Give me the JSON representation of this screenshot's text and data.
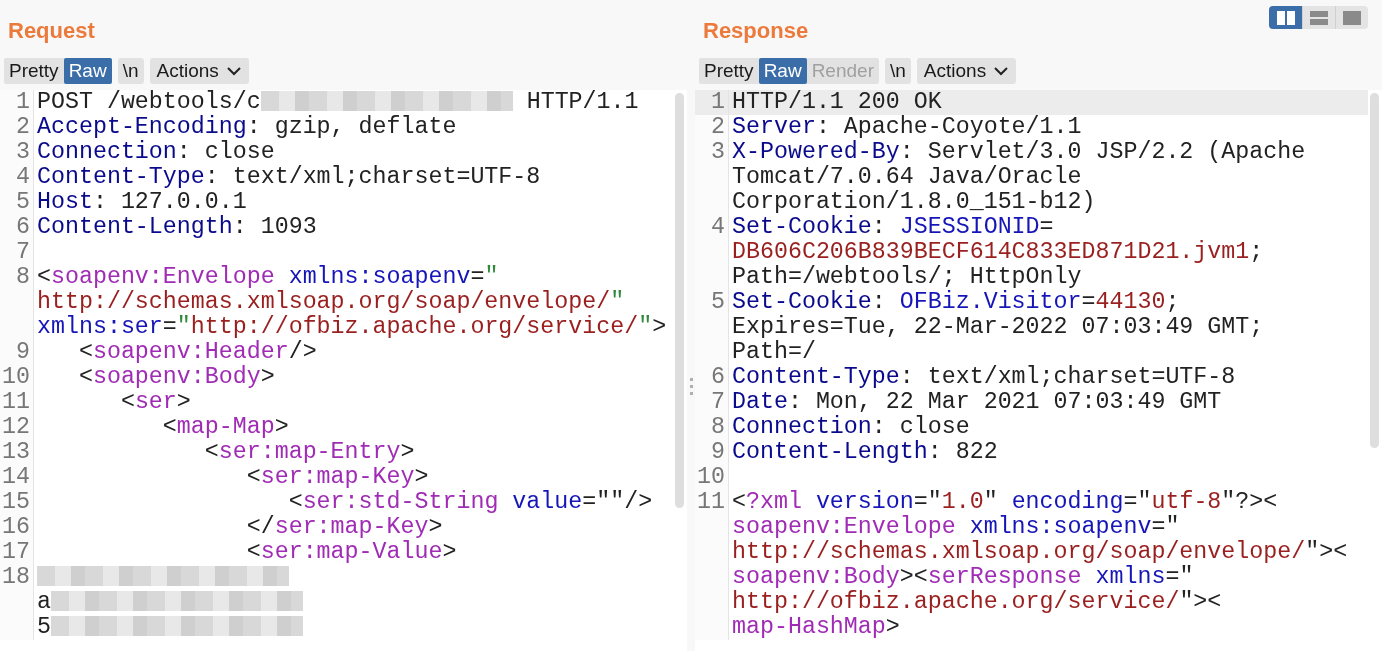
{
  "view_modes": [
    {
      "kind": "columns",
      "selected": true
    },
    {
      "kind": "rows",
      "selected": false
    },
    {
      "kind": "single",
      "selected": false
    }
  ],
  "panels": [
    {
      "title": "Request",
      "toolbar": [
        {
          "label": "Pretty",
          "kind": "tab",
          "selected": false,
          "disabled": false
        },
        {
          "label": "Raw",
          "kind": "tab",
          "selected": true,
          "disabled": false
        },
        {
          "label": "\\n",
          "kind": "toggle",
          "selected": false,
          "disabled": false
        },
        {
          "label": "Actions",
          "kind": "menu",
          "selected": false,
          "disabled": false
        }
      ],
      "lines": [
        {
          "number": "1",
          "highlighted": false,
          "rows": [
            {
              "spans": [
                {
                  "kind": "plain",
                  "text": "POST /webtools/c"
                },
                {
                  "kind": "redacted"
                },
                {
                  "kind": "plain",
                  "text": " HTTP/1.1"
                }
              ]
            }
          ]
        },
        {
          "number": "2",
          "highlighted": false,
          "rows": [
            {
              "spans": [
                {
                  "kind": "name",
                  "text": "Accept-Encoding"
                },
                {
                  "kind": "plain",
                  "text": ": gzip, deflate"
                }
              ]
            }
          ]
        },
        {
          "number": "3",
          "highlighted": false,
          "rows": [
            {
              "spans": [
                {
                  "kind": "name",
                  "text": "Connection"
                },
                {
                  "kind": "plain",
                  "text": ": close"
                }
              ]
            }
          ]
        },
        {
          "number": "4",
          "highlighted": false,
          "rows": [
            {
              "spans": [
                {
                  "kind": "name",
                  "text": "Content-Type"
                },
                {
                  "kind": "plain",
                  "text": ": text/xml;charset=UTF-8"
                }
              ]
            }
          ]
        },
        {
          "number": "5",
          "highlighted": false,
          "rows": [
            {
              "spans": [
                {
                  "kind": "name",
                  "text": "Host"
                },
                {
                  "kind": "plain",
                  "text": ": 127.0.0.1"
                }
              ]
            }
          ]
        },
        {
          "number": "6",
          "highlighted": false,
          "rows": [
            {
              "spans": [
                {
                  "kind": "name",
                  "text": "Content-Length"
                },
                {
                  "kind": "plain",
                  "text": ": 1093"
                }
              ]
            }
          ]
        },
        {
          "number": "7",
          "highlighted": false,
          "rows": [
            {
              "spans": []
            }
          ]
        },
        {
          "number": "8",
          "highlighted": false,
          "rows": [
            {
              "spans": [
                {
                  "kind": "plain",
                  "text": "<"
                },
                {
                  "kind": "tag",
                  "text": "soapenv:Envelope"
                },
                {
                  "kind": "attr",
                  "text": " xmlns:soapenv"
                },
                {
                  "kind": "plain",
                  "text": "="
                },
                {
                  "kind": "quote",
                  "text": "\""
                }
              ]
            },
            {
              "spans": [
                {
                  "kind": "string",
                  "text": "http://schemas.xmlsoap.org/soap/envelope/"
                },
                {
                  "kind": "quote",
                  "text": "\""
                }
              ]
            },
            {
              "spans": [
                {
                  "kind": "attr",
                  "text": "xmlns:ser"
                },
                {
                  "kind": "plain",
                  "text": "="
                },
                {
                  "kind": "quote",
                  "text": "\""
                },
                {
                  "kind": "string",
                  "text": "http://ofbiz.apache.org/service/"
                },
                {
                  "kind": "quote",
                  "text": "\""
                },
                {
                  "kind": "plain",
                  "text": ">"
                }
              ]
            }
          ]
        },
        {
          "number": "9",
          "highlighted": false,
          "rows": [
            {
              "spans": [
                {
                  "kind": "plain",
                  "text": "   <"
                },
                {
                  "kind": "tag",
                  "text": "soapenv:Header"
                },
                {
                  "kind": "plain",
                  "text": "/>"
                }
              ]
            }
          ]
        },
        {
          "number": "10",
          "highlighted": false,
          "rows": [
            {
              "spans": [
                {
                  "kind": "plain",
                  "text": "   <"
                },
                {
                  "kind": "tag",
                  "text": "soapenv:Body"
                },
                {
                  "kind": "plain",
                  "text": ">"
                }
              ]
            }
          ]
        },
        {
          "number": "11",
          "highlighted": false,
          "rows": [
            {
              "spans": [
                {
                  "kind": "plain",
                  "text": "      <"
                },
                {
                  "kind": "tag",
                  "text": "ser"
                },
                {
                  "kind": "plain",
                  "text": ">"
                }
              ]
            }
          ]
        },
        {
          "number": "12",
          "highlighted": false,
          "rows": [
            {
              "spans": [
                {
                  "kind": "plain",
                  "text": "         <"
                },
                {
                  "kind": "tag",
                  "text": "map-Map"
                },
                {
                  "kind": "plain",
                  "text": ">"
                }
              ]
            }
          ]
        },
        {
          "number": "13",
          "highlighted": false,
          "rows": [
            {
              "spans": [
                {
                  "kind": "plain",
                  "text": "            <"
                },
                {
                  "kind": "tag",
                  "text": "ser:map-Entry"
                },
                {
                  "kind": "plain",
                  "text": ">"
                }
              ]
            }
          ]
        },
        {
          "number": "14",
          "highlighted": false,
          "rows": [
            {
              "spans": [
                {
                  "kind": "plain",
                  "text": "               <"
                },
                {
                  "kind": "tag",
                  "text": "ser:map-Key"
                },
                {
                  "kind": "plain",
                  "text": ">"
                }
              ]
            }
          ]
        },
        {
          "number": "15",
          "highlighted": false,
          "rows": [
            {
              "spans": [
                {
                  "kind": "plain",
                  "text": "                  <"
                },
                {
                  "kind": "tag",
                  "text": "ser:std-String"
                },
                {
                  "kind": "attr",
                  "text": " value"
                },
                {
                  "kind": "plain",
                  "text": "=\"\"/>"
                }
              ]
            }
          ]
        },
        {
          "number": "16",
          "highlighted": false,
          "rows": [
            {
              "spans": [
                {
                  "kind": "plain",
                  "text": "               </"
                },
                {
                  "kind": "tag",
                  "text": "ser:map-Key"
                },
                {
                  "kind": "plain",
                  "text": ">"
                }
              ]
            }
          ]
        },
        {
          "number": "17",
          "highlighted": false,
          "rows": [
            {
              "spans": [
                {
                  "kind": "plain",
                  "text": "               <"
                },
                {
                  "kind": "tag",
                  "text": "ser:map-Value"
                },
                {
                  "kind": "plain",
                  "text": ">"
                }
              ]
            }
          ]
        },
        {
          "number": "18",
          "highlighted": false,
          "rows": [
            {
              "spans": [
                {
                  "kind": "redacted"
                }
              ]
            },
            {
              "spans": [
                {
                  "kind": "plain",
                  "text": "a"
                },
                {
                  "kind": "redacted"
                }
              ]
            },
            {
              "spans": [
                {
                  "kind": "plain",
                  "text": "5"
                },
                {
                  "kind": "redacted"
                }
              ]
            }
          ]
        }
      ]
    },
    {
      "title": "Response",
      "toolbar": [
        {
          "label": "Pretty",
          "kind": "tab",
          "selected": false,
          "disabled": false
        },
        {
          "label": "Raw",
          "kind": "tab",
          "selected": true,
          "disabled": false
        },
        {
          "label": "Render",
          "kind": "tab",
          "selected": false,
          "disabled": true
        },
        {
          "label": "\\n",
          "kind": "toggle",
          "selected": false,
          "disabled": false
        },
        {
          "label": "Actions",
          "kind": "menu",
          "selected": false,
          "disabled": false
        }
      ],
      "lines": [
        {
          "number": "1",
          "highlighted": true,
          "rows": [
            {
              "spans": [
                {
                  "kind": "plain",
                  "text": "HTTP/1.1 200 OK"
                }
              ]
            }
          ]
        },
        {
          "number": "2",
          "highlighted": false,
          "rows": [
            {
              "spans": [
                {
                  "kind": "name",
                  "text": "Server"
                },
                {
                  "kind": "plain",
                  "text": ": Apache-Coyote/1.1"
                }
              ]
            }
          ]
        },
        {
          "number": "3",
          "highlighted": false,
          "rows": [
            {
              "spans": [
                {
                  "kind": "name",
                  "text": "X-Powered-By"
                },
                {
                  "kind": "plain",
                  "text": ": Servlet/3.0 JSP/2.2 (Apache"
                }
              ]
            },
            {
              "spans": [
                {
                  "kind": "plain",
                  "text": "Tomcat/7.0.64 Java/Oracle"
                }
              ]
            },
            {
              "spans": [
                {
                  "kind": "plain",
                  "text": "Corporation/1.8.0_151-b12)"
                }
              ]
            }
          ]
        },
        {
          "number": "4",
          "highlighted": false,
          "rows": [
            {
              "spans": [
                {
                  "kind": "name",
                  "text": "Set-Cookie"
                },
                {
                  "kind": "plain",
                  "text": ": "
                },
                {
                  "kind": "attr",
                  "text": "JSESSIONID"
                },
                {
                  "kind": "plain",
                  "text": "="
                }
              ]
            },
            {
              "spans": [
                {
                  "kind": "string",
                  "text": "DB606C206B839BECF614C833ED871D21.jvm1"
                },
                {
                  "kind": "plain",
                  "text": ";"
                }
              ]
            },
            {
              "spans": [
                {
                  "kind": "plain",
                  "text": "Path=/webtools/; HttpOnly"
                }
              ]
            }
          ]
        },
        {
          "number": "5",
          "highlighted": false,
          "rows": [
            {
              "spans": [
                {
                  "kind": "name",
                  "text": "Set-Cookie"
                },
                {
                  "kind": "plain",
                  "text": ": "
                },
                {
                  "kind": "attr",
                  "text": "OFBiz.Visitor"
                },
                {
                  "kind": "plain",
                  "text": "="
                },
                {
                  "kind": "string",
                  "text": "44130"
                },
                {
                  "kind": "plain",
                  "text": ";"
                }
              ]
            },
            {
              "spans": [
                {
                  "kind": "plain",
                  "text": "Expires=Tue, 22-Mar-2022 07:03:49 GMT;"
                }
              ]
            },
            {
              "spans": [
                {
                  "kind": "plain",
                  "text": "Path=/"
                }
              ]
            }
          ]
        },
        {
          "number": "6",
          "highlighted": false,
          "rows": [
            {
              "spans": [
                {
                  "kind": "name",
                  "text": "Content-Type"
                },
                {
                  "kind": "plain",
                  "text": ": text/xml;charset=UTF-8"
                }
              ]
            }
          ]
        },
        {
          "number": "7",
          "highlighted": false,
          "rows": [
            {
              "spans": [
                {
                  "kind": "name",
                  "text": "Date"
                },
                {
                  "kind": "plain",
                  "text": ": Mon, 22 Mar 2021 07:03:49 GMT"
                }
              ]
            }
          ]
        },
        {
          "number": "8",
          "highlighted": false,
          "rows": [
            {
              "spans": [
                {
                  "kind": "name",
                  "text": "Connection"
                },
                {
                  "kind": "plain",
                  "text": ": close"
                }
              ]
            }
          ]
        },
        {
          "number": "9",
          "highlighted": false,
          "rows": [
            {
              "spans": [
                {
                  "kind": "name",
                  "text": "Content-Length"
                },
                {
                  "kind": "plain",
                  "text": ": 822"
                }
              ]
            }
          ]
        },
        {
          "number": "10",
          "highlighted": false,
          "rows": [
            {
              "spans": []
            }
          ]
        },
        {
          "number": "11",
          "highlighted": false,
          "rows": [
            {
              "spans": [
                {
                  "kind": "plain",
                  "text": "<"
                },
                {
                  "kind": "tag",
                  "text": "?xml"
                },
                {
                  "kind": "attr",
                  "text": " version"
                },
                {
                  "kind": "plain",
                  "text": "=\""
                },
                {
                  "kind": "string",
                  "text": "1.0"
                },
                {
                  "kind": "plain",
                  "text": "\" "
                },
                {
                  "kind": "attr",
                  "text": "encoding"
                },
                {
                  "kind": "plain",
                  "text": "=\""
                },
                {
                  "kind": "string",
                  "text": "utf-8"
                },
                {
                  "kind": "plain",
                  "text": "\"?><"
                }
              ]
            },
            {
              "spans": [
                {
                  "kind": "tag",
                  "text": "soapenv:Envelope"
                },
                {
                  "kind": "attr",
                  "text": " xmlns:soapenv"
                },
                {
                  "kind": "plain",
                  "text": "=\""
                }
              ]
            },
            {
              "spans": [
                {
                  "kind": "string",
                  "text": "http://schemas.xmlsoap.org/soap/envelope/"
                },
                {
                  "kind": "plain",
                  "text": "\"><"
                }
              ]
            },
            {
              "spans": [
                {
                  "kind": "tag",
                  "text": "soapenv:Body"
                },
                {
                  "kind": "plain",
                  "text": "><"
                },
                {
                  "kind": "tag",
                  "text": "serResponse"
                },
                {
                  "kind": "attr",
                  "text": " xmlns"
                },
                {
                  "kind": "plain",
                  "text": "=\""
                }
              ]
            },
            {
              "spans": [
                {
                  "kind": "string",
                  "text": "http://ofbiz.apache.org/service/"
                },
                {
                  "kind": "plain",
                  "text": "\"><"
                }
              ]
            },
            {
              "spans": [
                {
                  "kind": "tag",
                  "text": "map-HashMap"
                },
                {
                  "kind": "plain",
                  "text": ">"
                }
              ]
            }
          ]
        }
      ]
    }
  ]
}
